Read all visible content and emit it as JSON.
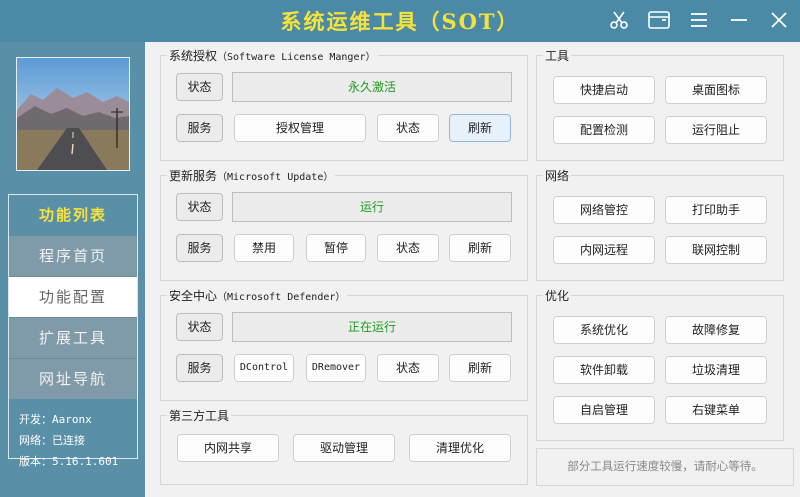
{
  "app": {
    "title": "系统运维工具（SOT）"
  },
  "titlebar_icons": [
    "scissors-icon",
    "window-icon",
    "menu-icon",
    "minimize-icon",
    "close-icon"
  ],
  "sidebar": {
    "menu_title": "功能列表",
    "items": [
      {
        "label": "程序首页",
        "active": false
      },
      {
        "label": "功能配置",
        "active": true
      },
      {
        "label": "扩展工具",
        "active": false
      },
      {
        "label": "网址导航",
        "active": false
      }
    ],
    "info": {
      "developer": "开发：Aaronx",
      "network": "网络：已连接",
      "version": "版本：5.16.1.601"
    }
  },
  "license": {
    "title_cn": "系统授权",
    "title_en": "（Software License Manger）",
    "status_label": "状态",
    "status_value": "永久激活",
    "service_label": "服务",
    "btn_manage": "授权管理",
    "btn_status": "状态",
    "btn_refresh": "刷新"
  },
  "update": {
    "title_cn": "更新服务",
    "title_en": "（Microsoft Update）",
    "status_label": "状态",
    "status_value": "运行",
    "service_label": "服务",
    "btn_disable": "禁用",
    "btn_pause": "暂停",
    "btn_status": "状态",
    "btn_refresh": "刷新"
  },
  "defender": {
    "title_cn": "安全中心",
    "title_en": "（Microsoft Defender）",
    "status_label": "状态",
    "status_value": "正在运行",
    "service_label": "服务",
    "btn_dcontrol": "DControl",
    "btn_dremover": "DRemover",
    "btn_status": "状态",
    "btn_refresh": "刷新"
  },
  "thirdparty": {
    "title": "第三方工具",
    "btn_share": "内网共享",
    "btn_driver": "驱动管理",
    "btn_clean": "清理优化"
  },
  "tools": {
    "title": "工具",
    "buttons": [
      "快捷启动",
      "桌面图标",
      "配置检测",
      "运行阻止"
    ]
  },
  "network": {
    "title": "网络",
    "buttons": [
      "网络管控",
      "打印助手",
      "内网远程",
      "联网控制"
    ]
  },
  "optimize": {
    "title": "优化",
    "buttons": [
      "系统优化",
      "故障修复",
      "软件卸载",
      "垃圾清理",
      "自启管理",
      "右键菜单"
    ]
  },
  "note": "部分工具运行速度较慢，请耐心等待。"
}
